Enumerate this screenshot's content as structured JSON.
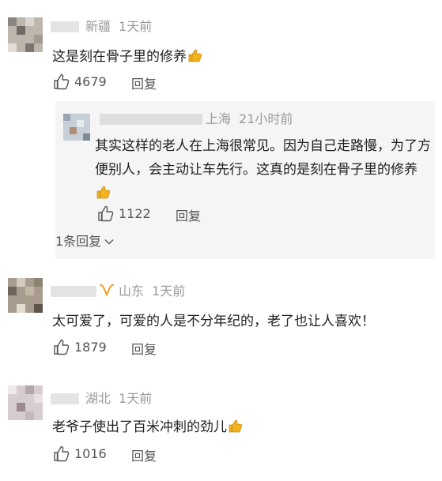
{
  "comments": [
    {
      "location": "新疆",
      "time": "1天前",
      "text": "这是刻在骨子里的修养",
      "emoji": "thumbs-up-icon",
      "likes": "4679",
      "reply_label": "回复",
      "reply": {
        "location": "上海",
        "time": "21小时前",
        "text": "其实这样的老人在上海很常见。因为自己走路慢，为了方便别人，会主动让车先行。这真的是刻在骨子里的修养",
        "emoji": "thumbs-up-icon",
        "likes": "1122",
        "reply_label": "回复"
      },
      "more_replies": "1条回复"
    },
    {
      "location": "山东",
      "time": "1天前",
      "text": "太可爱了，可爱的人是不分年纪的，老了也让人喜欢！",
      "likes": "1879",
      "reply_label": "回复"
    },
    {
      "location": "湖北",
      "time": "1天前",
      "text": "老爷子使出了百米冲刺的劲儿",
      "emoji": "thumbs-up-icon",
      "likes": "1016",
      "reply_label": "回复"
    }
  ],
  "colors": {
    "meta_text": "#9a9a9a",
    "body_text": "#1f1f1f",
    "action_text": "#555555",
    "reply_bg": "#f5f5f5",
    "verified": "#f0a020",
    "emoji": "#f2b31c"
  }
}
